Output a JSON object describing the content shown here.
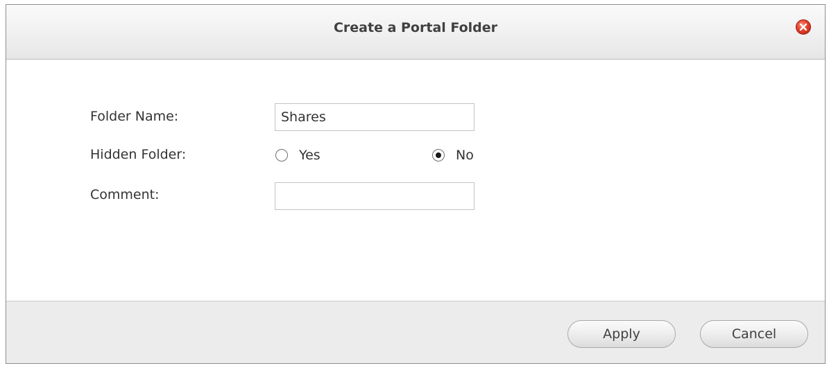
{
  "dialog": {
    "title": "Create a Portal Folder",
    "close_icon": "close-icon"
  },
  "form": {
    "folder_name_label": "Folder Name:",
    "folder_name_value": "Shares",
    "hidden_folder_label": "Hidden Folder:",
    "hidden_options": [
      {
        "label": "Yes",
        "checked": false
      },
      {
        "label": "No",
        "checked": true
      }
    ],
    "comment_label": "Comment:",
    "comment_value": ""
  },
  "buttons": {
    "apply_label": "Apply",
    "cancel_label": "Cancel"
  },
  "colors": {
    "close_button": "#e2402c",
    "footer_background": "#ececec"
  }
}
